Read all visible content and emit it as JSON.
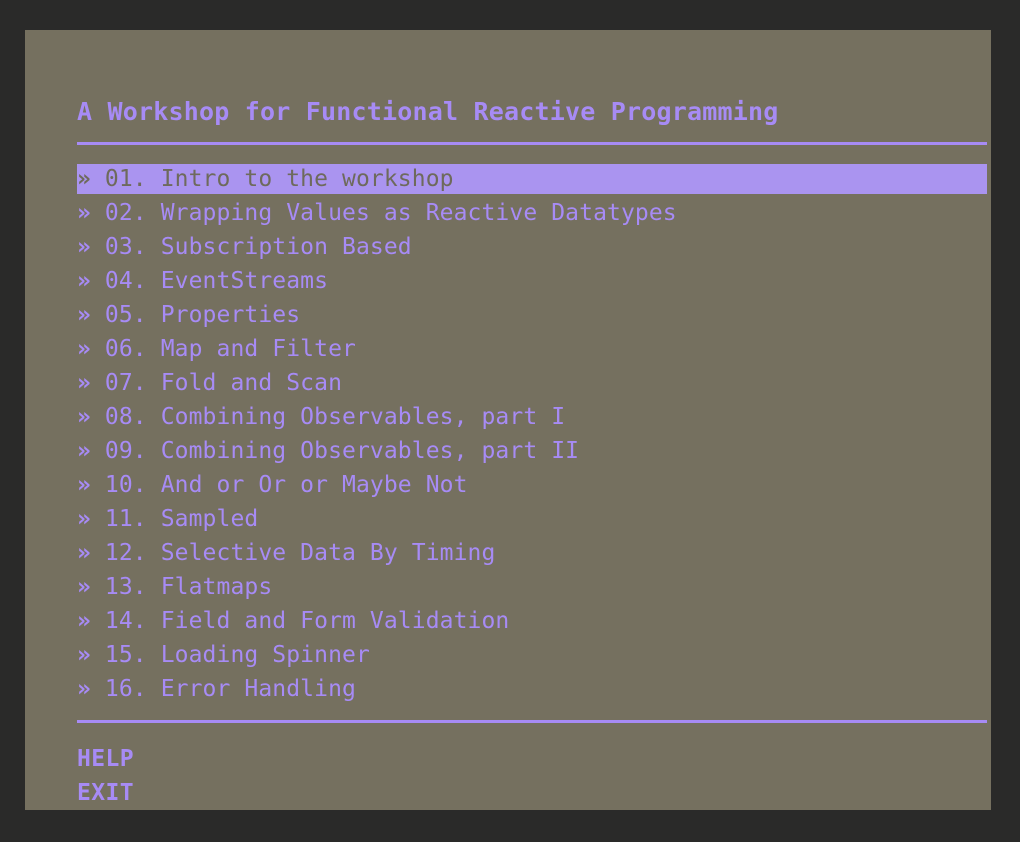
{
  "app": {
    "title": "A Workshop for Functional Reactive Programming",
    "background_color": "#2a2a29",
    "panel_color": "#75705f",
    "accent_color": "#a78bf5",
    "selection_background": "#aa94f0",
    "selection_text_color": "#6e6a5c"
  },
  "menu": {
    "marker": "»",
    "selected_index": 0,
    "items": [
      {
        "marker": "»",
        "number": "01.",
        "label": "Intro to the workshop",
        "selected": true
      },
      {
        "marker": "»",
        "number": "02.",
        "label": "Wrapping Values as Reactive Datatypes",
        "selected": false
      },
      {
        "marker": "»",
        "number": "03.",
        "label": "Subscription Based",
        "selected": false
      },
      {
        "marker": "»",
        "number": "04.",
        "label": "EventStreams",
        "selected": false
      },
      {
        "marker": "»",
        "number": "05.",
        "label": "Properties",
        "selected": false
      },
      {
        "marker": "»",
        "number": "06.",
        "label": "Map and Filter",
        "selected": false
      },
      {
        "marker": "»",
        "number": "07.",
        "label": "Fold and Scan",
        "selected": false
      },
      {
        "marker": "»",
        "number": "08.",
        "label": "Combining Observables, part I",
        "selected": false
      },
      {
        "marker": "»",
        "number": "09.",
        "label": "Combining Observables, part II",
        "selected": false
      },
      {
        "marker": "»",
        "number": "10.",
        "label": "And or Or or Maybe Not",
        "selected": false
      },
      {
        "marker": "»",
        "number": "11.",
        "label": "Sampled",
        "selected": false
      },
      {
        "marker": "»",
        "number": "12.",
        "label": "Selective Data By Timing",
        "selected": false
      },
      {
        "marker": "»",
        "number": "13.",
        "label": "Flatmaps",
        "selected": false
      },
      {
        "marker": "»",
        "number": "14.",
        "label": "Field and Form Validation",
        "selected": false
      },
      {
        "marker": "»",
        "number": "15.",
        "label": "Loading Spinner",
        "selected": false
      },
      {
        "marker": "»",
        "number": "16.",
        "label": "Error Handling",
        "selected": false
      }
    ]
  },
  "footer": {
    "actions": [
      {
        "label": "HELP"
      },
      {
        "label": "EXIT"
      }
    ]
  }
}
